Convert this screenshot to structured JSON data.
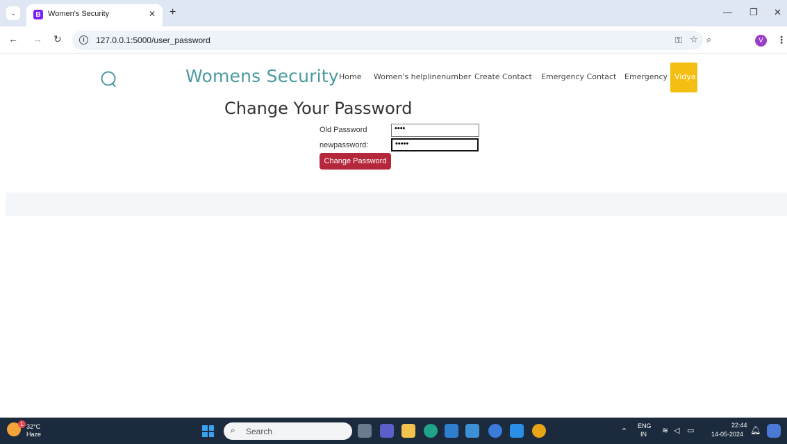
{
  "browser": {
    "tab_title": "Women's Security",
    "tab_favicon_letter": "B",
    "url": "127.0.0.1:5000/user_password",
    "profile_initial": "V"
  },
  "site": {
    "brand": "Womens Security",
    "nav": [
      {
        "label": "Home"
      },
      {
        "label": "Women's helplinenumber"
      },
      {
        "label": "Create Contact"
      },
      {
        "label": "Emergency Contact"
      },
      {
        "label": "Emergency"
      }
    ],
    "user_name": "Vidya",
    "accent_color": "#f5be12",
    "brand_color": "#4b9aa0"
  },
  "form": {
    "heading": "Change Your Password",
    "old_password_label": "Old Password",
    "old_password_value": "••••",
    "new_password_label": "newpassword:",
    "new_password_value": "•••••",
    "submit_label": "Change Password",
    "submit_color": "#b5283c"
  },
  "taskbar": {
    "weather_temp": "32°C",
    "weather_desc": "Haze",
    "weather_badge": "1",
    "search_placeholder": "Search",
    "lang_top": "ENG",
    "lang_bottom": "IN",
    "time": "22:44",
    "date": "14-05-2024"
  }
}
